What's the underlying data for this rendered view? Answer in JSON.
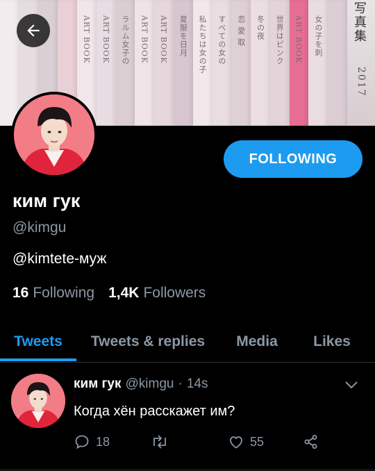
{
  "banner": {
    "spines": [
      {
        "color": "#f2ecee",
        "text": ""
      },
      {
        "color": "#e6dde1",
        "text": ""
      },
      {
        "color": "#d9cfd4",
        "text": ""
      },
      {
        "color": "#e9cfd6",
        "text": ""
      },
      {
        "color": "#f1e6ea",
        "text": "ART BOOK"
      },
      {
        "color": "#e7dde2",
        "text": "ART BOOK"
      },
      {
        "color": "#dccdd3",
        "text": "ラルム女子の"
      },
      {
        "color": "#efe3e7",
        "text": "ART BOOK"
      },
      {
        "color": "#e6d7dd",
        "text": "ART BOOK"
      },
      {
        "color": "#d8c6cf",
        "text": "夏服を日月"
      },
      {
        "color": "#f2e7eb",
        "text": "私たちは女の子"
      },
      {
        "color": "#eadde2",
        "text": "すべての女の"
      },
      {
        "color": "#dfd0d6",
        "text": "恋 愛 取"
      },
      {
        "color": "#ecdfe4",
        "text": "冬の夜"
      },
      {
        "color": "#e3d4da",
        "text": "世界はピンク"
      },
      {
        "color": "#e66e93",
        "text": "ART BOOK"
      },
      {
        "color": "#eadde2",
        "text": "女の子を刺"
      },
      {
        "color": "#dbcdd3",
        "text": ""
      }
    ],
    "title": "写真集",
    "year": "2017"
  },
  "profile": {
    "name": "ким гук",
    "handle": "@kimgu",
    "bio": "@kimtete-муж",
    "following_count": "16",
    "following_label": "Following",
    "followers_count": "1,4K",
    "followers_label": "Followers",
    "follow_button": "FOLLOWING"
  },
  "tabs": [
    {
      "label": "Tweets"
    },
    {
      "label": "Tweets & replies"
    },
    {
      "label": "Media"
    },
    {
      "label": "Likes"
    }
  ],
  "tweet": {
    "name": "ким гук",
    "handle": "@kimgu",
    "sep": "·",
    "time": "14s",
    "text": "Когда хён расскажет им?",
    "replies": "18",
    "likes": "55"
  },
  "colors": {
    "accent": "#1d9bf0",
    "muted": "#8b98a5",
    "background": "#000000"
  },
  "icons": {
    "back": "arrow-left-icon",
    "reply": "reply-icon",
    "retweet": "retweet-icon",
    "like": "heart-icon",
    "share": "share-icon",
    "more": "chevron-down-icon"
  }
}
